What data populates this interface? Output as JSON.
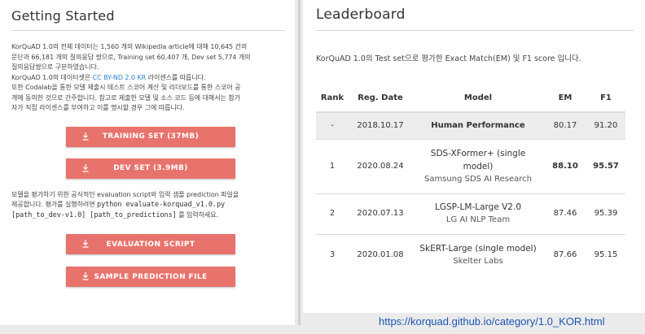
{
  "getting_started": {
    "title": "Getting Started",
    "para1": [
      "KorQuAD 1.0의 전체 데이터는 1,560 개의 Wikipedia article에 대해 10,645 건의",
      "문단과 66,181 개의 질의응답 쌍으로, Training set 60,407 개, Dev set 5,774 개의",
      "질의응답쌍으로 구분하였습니다."
    ],
    "license_prefix": "KorQuAD 1.0의 데이터셋은 ",
    "license_link": "CC BY-ND 2.0 KR",
    "license_suffix": " 라이센스를 따릅니다.",
    "para2": [
      "또한 Codalab을 통한 모델 제출시 테스트 스코어 계산 및 리더보드를 통한 스코어 공",
      "개에 동의한 것으로 간주합니다. 참고로 제출한 모델 및 소스 코드 등에 대해서는 참가",
      "자가 직접 라이센스를 부여하고 이를 명시할 경우 그에 따릅니다."
    ],
    "buttons": {
      "training": "TRAINING SET (37MB)",
      "dev": "DEV SET (3.9MB)",
      "eval": "EVALUATION SCRIPT",
      "sample": "SAMPLE PREDICTION FILE"
    },
    "eval_para": [
      "모델을 평가하기 위한 공식적인 evaluation script와 입력 샘플 prediction 파일을",
      "제공합니다. 평가를 실행하려면 "
    ],
    "eval_cmd1": "python evaluate-korquad_v1.0.py",
    "eval_cmd2": "[path_to_dev-v1.0] [path_to_predictions]",
    "eval_suffix": " 를 입력하세요."
  },
  "leaderboard": {
    "title": "Leaderboard",
    "description": "KorQuAD 1.0의 Test set으로 평가한 Exact Match(EM) 및 F1 score 입니다.",
    "headers": [
      "Rank",
      "Reg. Date",
      "Model",
      "EM",
      "F1"
    ],
    "rows": [
      {
        "rank": "-",
        "date": "2018.10.17",
        "model": "Human Performance",
        "org": "",
        "em": "80.17",
        "f1": "91.20"
      },
      {
        "rank": "1",
        "date": "2020.08.24",
        "model": "SDS-XFormer+ (single model)",
        "org": "Samsung SDS AI Research",
        "em": "88.10",
        "f1": "95.57"
      },
      {
        "rank": "2",
        "date": "2020.07.13",
        "model": "LGSP-LM-Large V2.0",
        "org": "LG AI NLP Team",
        "em": "87.46",
        "f1": "95.39"
      },
      {
        "rank": "3",
        "date": "2020.01.08",
        "model": "SkERT-Large (single model)",
        "org": "Skelter Labs",
        "em": "87.66",
        "f1": "95.15"
      }
    ]
  },
  "url": "https://korquad.github.io/category/1.0_KOR.html",
  "colors": {
    "button": "#e8736c",
    "link": "#2a7fd0",
    "url": "#1a56b0"
  }
}
